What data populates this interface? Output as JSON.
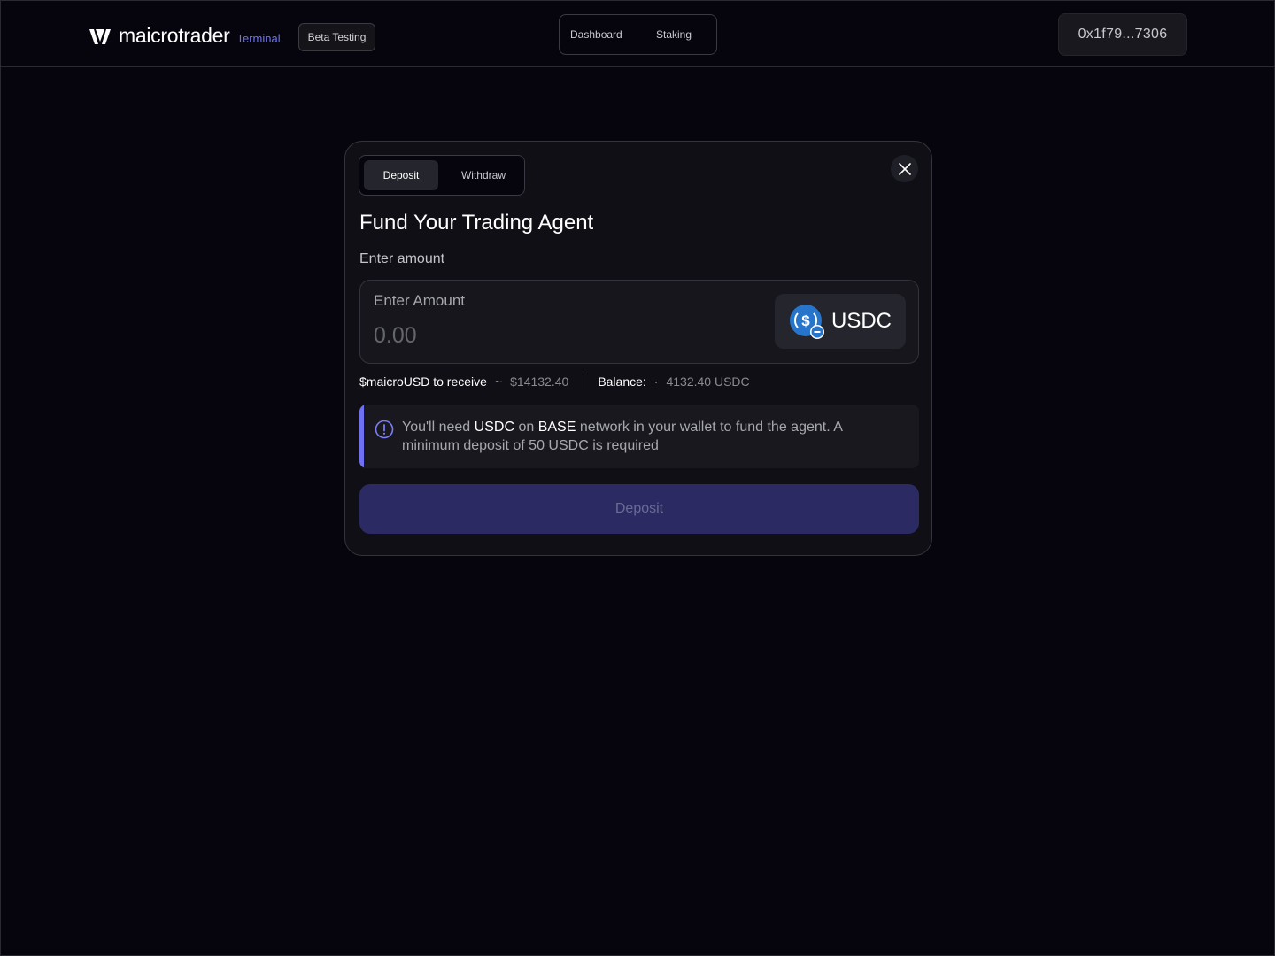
{
  "header": {
    "brand": "maicrotrader",
    "brand_sub": "Terminal",
    "badge": "Beta Testing",
    "nav": [
      {
        "label": "Dashboard"
      },
      {
        "label": "Staking"
      }
    ],
    "wallet_address": "0x1f79...7306"
  },
  "modal": {
    "tabs": [
      {
        "label": "Deposit",
        "active": true
      },
      {
        "label": "Withdraw",
        "active": false
      }
    ],
    "title": "Fund Your Trading Agent",
    "amount_label": "Enter amount",
    "amount_box_label": "Enter Amount",
    "amount_value": "",
    "amount_placeholder": "0.00",
    "token": {
      "name": "USDC",
      "icon": "usdc-coin-icon"
    },
    "receive_label": "$maicroUSD to receive",
    "receive_sep": "~",
    "receive_value": "$14132.40",
    "balance_label": "Balance:",
    "balance_sep": "·",
    "balance_value": "4132.40 USDC",
    "notice": {
      "p1": "You'll need ",
      "token": "USDC",
      "p2": " on ",
      "network": "BASE",
      "p3": " network in your wallet to fund the agent. A minimum deposit of 50 USDC is required"
    },
    "deposit_button": "Deposit"
  },
  "colors": {
    "background": "#06050d",
    "modal": "#0f0f15",
    "accent": "#6f71f2",
    "button_disabled": "#2c2a63",
    "usdc_blue": "#2775ca"
  }
}
